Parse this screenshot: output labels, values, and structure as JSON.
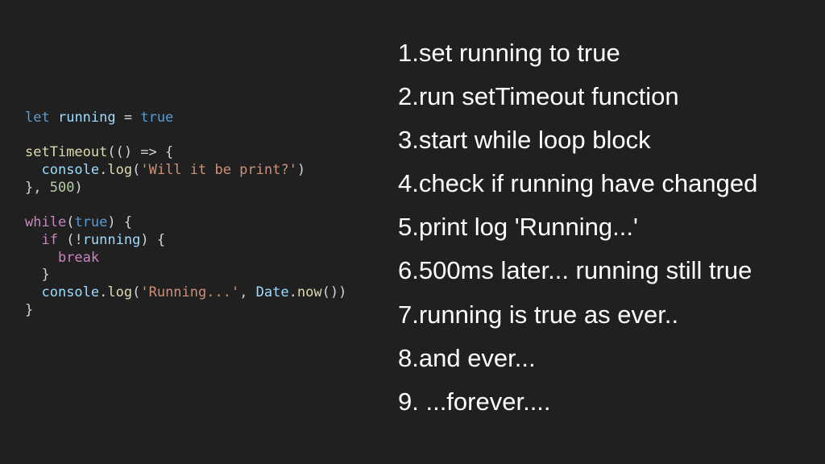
{
  "code": {
    "lines": [
      [
        {
          "t": "let",
          "c": "kw"
        },
        {
          "t": " ",
          "c": "punc"
        },
        {
          "t": "running",
          "c": "var"
        },
        {
          "t": " = ",
          "c": "punc"
        },
        {
          "t": "true",
          "c": "kw"
        }
      ],
      [],
      [
        {
          "t": "setTimeout",
          "c": "fn"
        },
        {
          "t": "(() => {",
          "c": "punc"
        }
      ],
      [
        {
          "t": "  ",
          "c": "punc"
        },
        {
          "t": "console",
          "c": "var"
        },
        {
          "t": ".",
          "c": "punc"
        },
        {
          "t": "log",
          "c": "fn"
        },
        {
          "t": "(",
          "c": "punc"
        },
        {
          "t": "'Will it be print?'",
          "c": "str"
        },
        {
          "t": ")",
          "c": "punc"
        }
      ],
      [
        {
          "t": "}, ",
          "c": "punc"
        },
        {
          "t": "500",
          "c": "num"
        },
        {
          "t": ")",
          "c": "punc"
        }
      ],
      [],
      [
        {
          "t": "while",
          "c": "ctl"
        },
        {
          "t": "(",
          "c": "punc"
        },
        {
          "t": "true",
          "c": "kw"
        },
        {
          "t": ") {",
          "c": "punc"
        }
      ],
      [
        {
          "t": "  ",
          "c": "punc"
        },
        {
          "t": "if",
          "c": "ctl"
        },
        {
          "t": " (!",
          "c": "punc"
        },
        {
          "t": "running",
          "c": "var"
        },
        {
          "t": ") {",
          "c": "punc"
        }
      ],
      [
        {
          "t": "    ",
          "c": "punc"
        },
        {
          "t": "break",
          "c": "ctl"
        }
      ],
      [
        {
          "t": "  }",
          "c": "punc"
        }
      ],
      [
        {
          "t": "  ",
          "c": "punc"
        },
        {
          "t": "console",
          "c": "var"
        },
        {
          "t": ".",
          "c": "punc"
        },
        {
          "t": "log",
          "c": "fn"
        },
        {
          "t": "(",
          "c": "punc"
        },
        {
          "t": "'Running...'",
          "c": "str"
        },
        {
          "t": ", ",
          "c": "punc"
        },
        {
          "t": "Date",
          "c": "var"
        },
        {
          "t": ".",
          "c": "punc"
        },
        {
          "t": "now",
          "c": "fn"
        },
        {
          "t": "())",
          "c": "punc"
        }
      ],
      [
        {
          "t": "}",
          "c": "punc"
        }
      ]
    ]
  },
  "steps": [
    "1.set running to true",
    "2.run setTimeout function",
    "3.start while loop block",
    "4.check if running have changed",
    "5.print log 'Running...'",
    "6.500ms later... running still true",
    "7.running is true as ever..",
    "8.and ever...",
    "9. ...forever...."
  ]
}
